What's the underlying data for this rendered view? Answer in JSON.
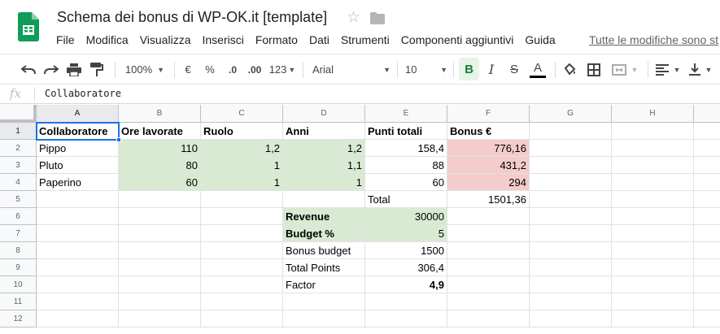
{
  "doc": {
    "title": "Schema dei bonus di WP-OK.it [template]",
    "star_icon": "star-icon",
    "folder_icon": "folder-icon"
  },
  "menu": [
    "File",
    "Modifica",
    "Visualizza",
    "Inserisci",
    "Formato",
    "Dati",
    "Strumenti",
    "Componenti aggiuntivi",
    "Guida"
  ],
  "last_edit": "Tutte le modifiche sono st",
  "toolbar": {
    "zoom": "100%",
    "currency": "€",
    "percent": "%",
    "decrease_decimals": ".0",
    "increase_decimals": ".00",
    "more_formats": "123",
    "font": "Arial",
    "font_size": "10",
    "bold": "B",
    "italic": "I",
    "strike": "S",
    "text_color": "A",
    "text_color_value": "#000000"
  },
  "formula_bar": {
    "fx": "fx",
    "content": "Collaboratore"
  },
  "columns": [
    "A",
    "B",
    "C",
    "D",
    "E",
    "F",
    "G",
    "H"
  ],
  "rows": [
    "1",
    "2",
    "3",
    "4",
    "5",
    "6",
    "7",
    "8",
    "9",
    "10",
    "11",
    "12"
  ],
  "colors": {
    "green_fill": "#d9ead3",
    "red_fill": "#f4cccc",
    "selection": "#1a73e8",
    "bold_active": "#188038"
  },
  "cells": {
    "A1": "Collaboratore",
    "B1": "Ore lavorate",
    "C1": "Ruolo",
    "D1": "Anni",
    "E1": "Punti totali",
    "F1": "Bonus €",
    "A2": "Pippo",
    "B2": "110",
    "C2": "1,2",
    "D2": "1,2",
    "E2": "158,4",
    "F2": "776,16",
    "A3": "Pluto",
    "B3": "80",
    "C3": "1",
    "D3": "1,1",
    "E3": "88",
    "F3": "431,2",
    "A4": "Paperino",
    "B4": "60",
    "C4": "1",
    "D4": "1",
    "E4": "60",
    "F4": "294",
    "E5": "Total",
    "F5": "1501,36",
    "D6": "Revenue",
    "E6": "30000",
    "D7": "Budget %",
    "E7": "5",
    "D8": "Bonus budget",
    "E8": "1500",
    "D9": "Total Points",
    "E9": "306,4",
    "D10": "Factor",
    "E10": "4,9"
  }
}
